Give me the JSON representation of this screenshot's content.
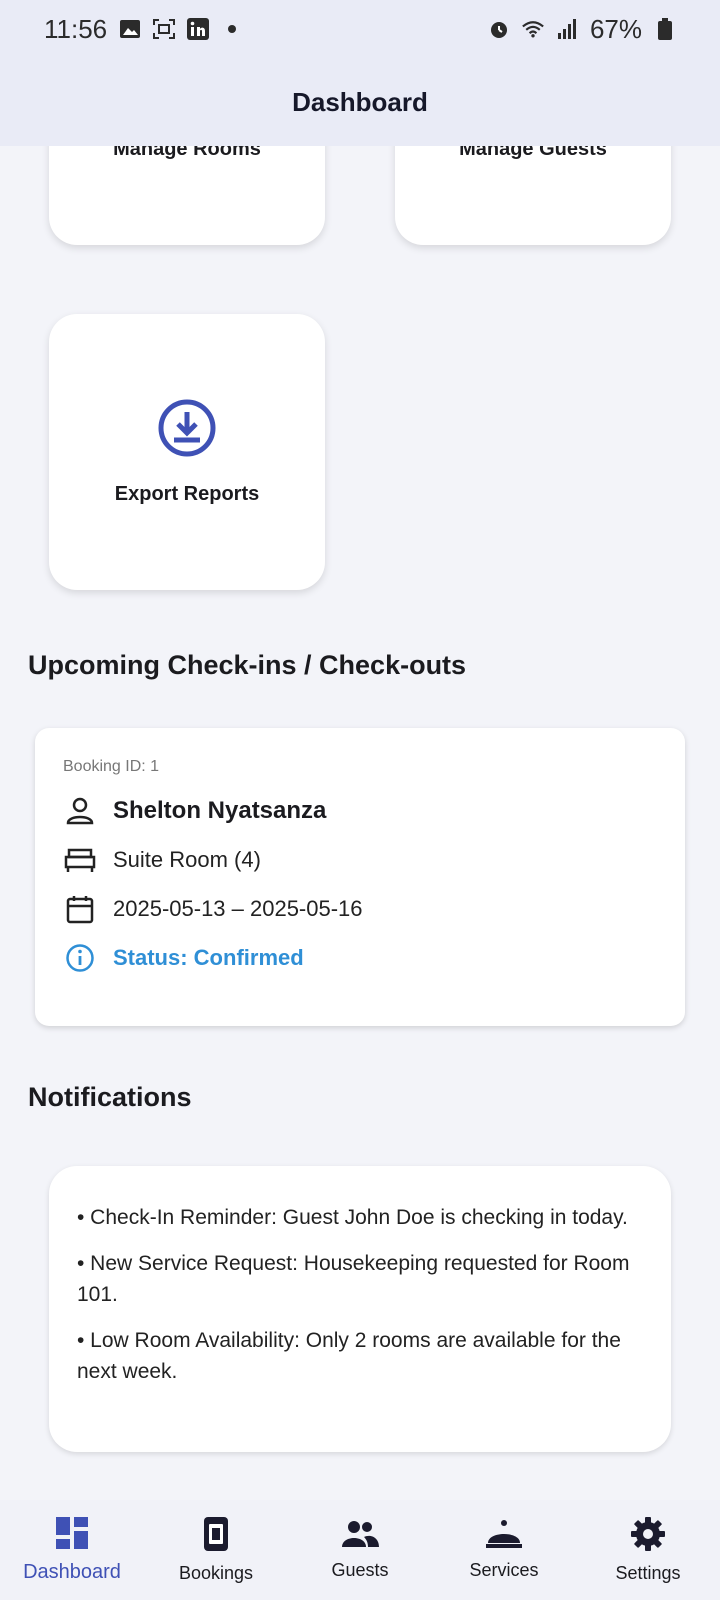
{
  "status_bar": {
    "time": "11:56",
    "battery": "67%"
  },
  "app_bar": {
    "title": "Dashboard"
  },
  "tiles": {
    "manage_rooms": "Manage Rooms",
    "manage_guests": "Manage Guests",
    "export_reports": "Export Reports"
  },
  "sections": {
    "upcoming": "Upcoming Check-ins / Check-outs",
    "notifications": "Notifications"
  },
  "booking": {
    "id_label": "Booking ID: 1",
    "guest": "Shelton Nyatsanza",
    "room": "Suite Room (4)",
    "dates": "2025-05-13 – 2025-05-16",
    "status": "Status: Confirmed"
  },
  "notifications": [
    "• Check-In Reminder: Guest John Doe is checking in today.",
    "• New Service Request: Housekeeping requested for Room 101.",
    "• Low Room Availability: Only 2 rooms are available for the next week."
  ],
  "nav": [
    {
      "label": "Dashboard",
      "icon": "dashboard-icon"
    },
    {
      "label": "Bookings",
      "icon": "bookings-icon"
    },
    {
      "label": "Guests",
      "icon": "guests-icon"
    },
    {
      "label": "Services",
      "icon": "services-icon"
    },
    {
      "label": "Settings",
      "icon": "settings-icon"
    }
  ],
  "colors": {
    "accent": "#3f51b5",
    "status": "#2f8fd6",
    "appbar": "#e9ebf6"
  }
}
